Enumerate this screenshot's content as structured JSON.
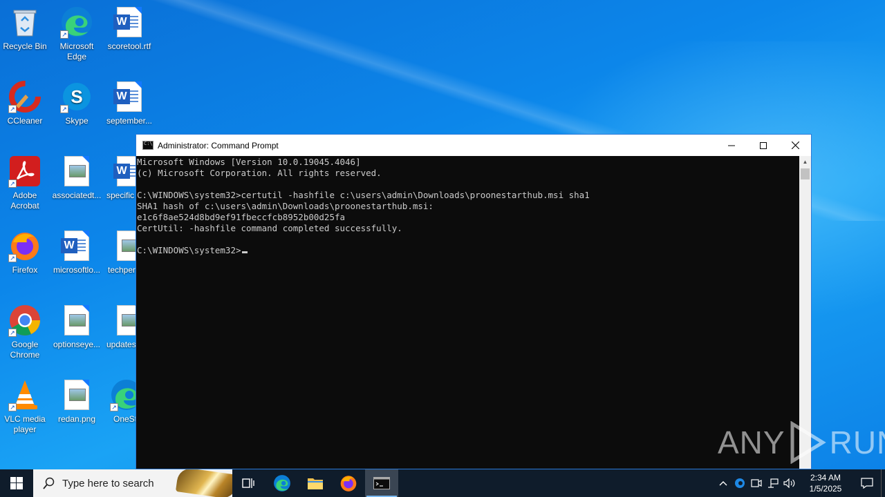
{
  "desktop": {
    "icons": [
      {
        "label": "Recycle Bin",
        "icon": "recycle-bin-icon"
      },
      {
        "label": "Microsoft Edge",
        "icon": "edge-icon"
      },
      {
        "label": "scoretool.rtf",
        "icon": "word-document-icon"
      },
      {
        "label": "CCleaner",
        "icon": "ccleaner-icon"
      },
      {
        "label": "Skype",
        "icon": "skype-icon"
      },
      {
        "label": "september...",
        "icon": "word-document-icon"
      },
      {
        "label": "Adobe Acrobat",
        "icon": "acrobat-icon"
      },
      {
        "label": "associatedt...",
        "icon": "image-file-icon"
      },
      {
        "label": "specific",
        "icon": "word-document-icon"
      },
      {
        "label": "Firefox",
        "icon": "firefox-icon"
      },
      {
        "label": "microsoftlo...",
        "icon": "word-document-icon"
      },
      {
        "label": "techper",
        "icon": "image-file-icon"
      },
      {
        "label": "Google Chrome",
        "icon": "chrome-icon"
      },
      {
        "label": "optionseye...",
        "icon": "image-file-icon"
      },
      {
        "label": "updates",
        "icon": "image-file-icon"
      },
      {
        "label": "VLC media player",
        "icon": "vlc-icon"
      },
      {
        "label": "redan.png",
        "icon": "image-file-icon"
      },
      {
        "label": "OneSt",
        "icon": "edge-icon"
      }
    ]
  },
  "cmd": {
    "title": "Administrator: Command Prompt",
    "lines": [
      "Microsoft Windows [Version 10.0.19045.4046]",
      "(c) Microsoft Corporation. All rights reserved.",
      "",
      "C:\\WINDOWS\\system32>certutil -hashfile c:\\users\\admin\\Downloads\\proonestarthub.msi sha1",
      "SHA1 hash of c:\\users\\admin\\Downloads\\proonestarthub.msi:",
      "e1c6f8ae524d8bd9ef91fbeccfcb8952b00d25fa",
      "CertUtil: -hashfile command completed successfully.",
      ""
    ],
    "prompt": "C:\\WINDOWS\\system32>"
  },
  "watermark": {
    "left": "ANY",
    "right": "RUN"
  },
  "taskbar": {
    "search_placeholder": "Type here to search",
    "clock_time": "2:34 AM",
    "clock_date": "1/5/2025"
  },
  "colors": {
    "console_bg": "#0c0c0c",
    "console_fg": "#cccccc",
    "taskbar_bg": "#0f1c2b",
    "accent": "#2a79d7"
  }
}
